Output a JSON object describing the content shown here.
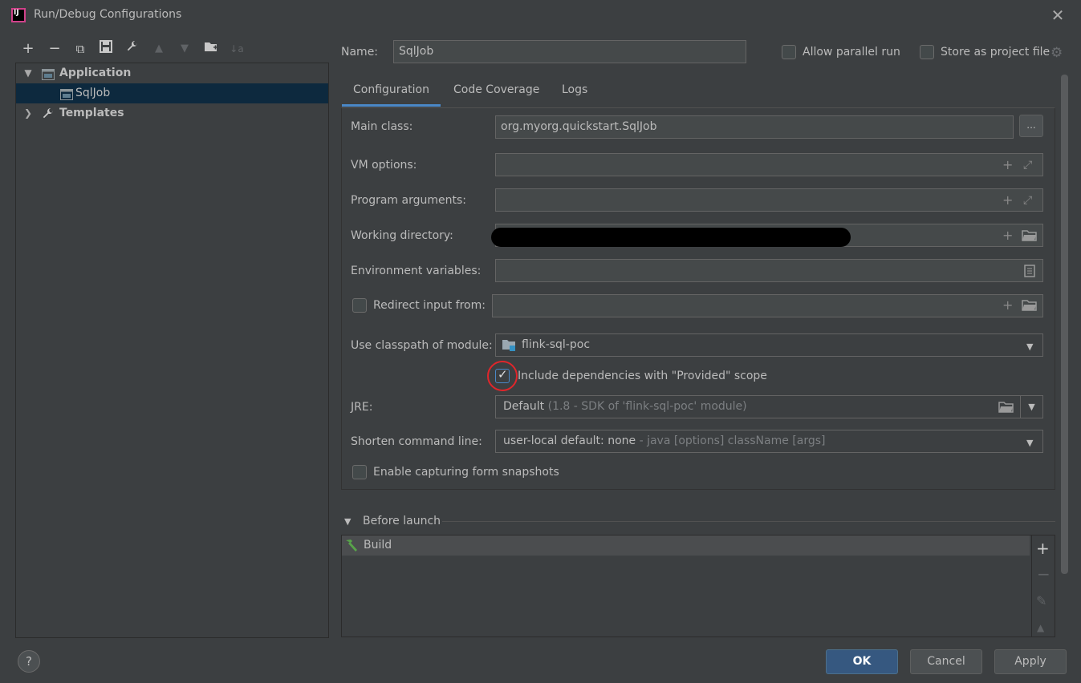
{
  "window": {
    "title": "Run/Debug Configurations",
    "close": "✕"
  },
  "toolbar": {
    "add": "+",
    "remove": "−",
    "copy": "⧉",
    "save": "💾",
    "edit": "🔧",
    "move_up": "▲",
    "move_down": "▼",
    "new_folder": "📁",
    "sort": "↓a"
  },
  "tree": {
    "application_label": "Application",
    "sqljob_label": "SqlJob",
    "templates_label": "Templates"
  },
  "form": {
    "name_label": "Name:",
    "name_value": "SqlJob",
    "allow_parallel_label": "Allow parallel run",
    "store_project_label": "Store as project file",
    "tabs": [
      "Configuration",
      "Code Coverage",
      "Logs"
    ],
    "main_class_label": "Main class:",
    "main_class_value": "org.myorg.quickstart.SqlJob",
    "browse_label": "...",
    "vm_options_label": "VM options:",
    "program_args_label": "Program arguments:",
    "working_dir_label": "Working directory:",
    "env_vars_label": "Environment variables:",
    "redirect_label": "Redirect input from:",
    "classpath_label": "Use classpath of module:",
    "classpath_value": "flink-sql-poc",
    "include_deps_label": "Include dependencies with \"Provided\" scope",
    "jre_label": "JRE:",
    "jre_value": "Default",
    "jre_hint": "(1.8 - SDK of 'flink-sql-poc' module)",
    "shorten_label": "Shorten command line:",
    "shorten_value": "user-local default: none",
    "shorten_hint": "- java [options] className [args]",
    "snapshots_label": "Enable capturing form snapshots"
  },
  "before_launch": {
    "title": "Before launch",
    "items": [
      "Build"
    ]
  },
  "buttons": {
    "ok": "OK",
    "cancel": "Cancel",
    "apply": "Apply",
    "help": "?"
  },
  "colors": {
    "accent": "#4a88c7",
    "selection": "#0d293e",
    "highlight_circle": "#e0262b"
  }
}
